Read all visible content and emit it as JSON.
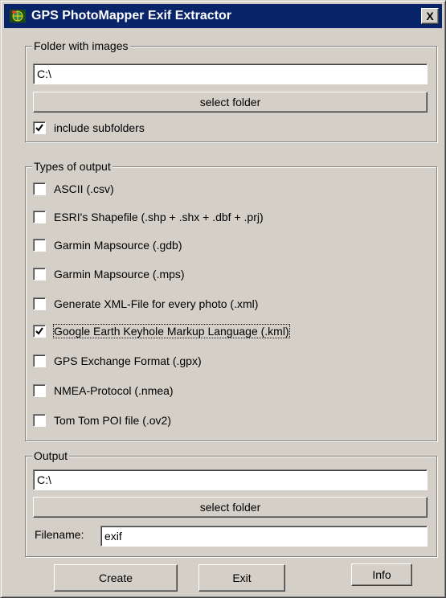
{
  "window": {
    "title": "GPS PhotoMapper Exif Extractor",
    "close_glyph": "X"
  },
  "folder_group": {
    "legend": "Folder with images",
    "path_value": "C:\\",
    "select_label": "select folder",
    "subfolders_label": "include subfolders",
    "subfolders_checked": true
  },
  "types_group": {
    "legend": "Types of output",
    "items": [
      {
        "label": "ASCII (.csv)",
        "checked": false
      },
      {
        "label": "ESRI's Shapefile (.shp + .shx + .dbf + .prj)",
        "checked": false
      },
      {
        "label": "Garmin Mapsource (.gdb)",
        "checked": false
      },
      {
        "label": "Garmin Mapsource (.mps)",
        "checked": false
      },
      {
        "label": "Generate XML-File for every photo (.xml)",
        "checked": false
      },
      {
        "label": "Google Earth Keyhole Markup Language (.kml)",
        "checked": true
      },
      {
        "label": "GPS Exchange Format (.gpx)",
        "checked": false
      },
      {
        "label": "NMEA-Protocol (.nmea)",
        "checked": false
      },
      {
        "label": "Tom Tom POI file (.ov2)",
        "checked": false
      }
    ]
  },
  "output_group": {
    "legend": "Output",
    "path_value": "C:\\",
    "select_label": "select folder",
    "filename_label": "Filename:",
    "filename_value": "exif"
  },
  "buttons": {
    "create": "Create",
    "exit": "Exit",
    "info": "Info"
  },
  "icons": {
    "app": "gps-globe-icon",
    "check": "checkmark-icon",
    "close": "close-icon"
  },
  "colors": {
    "titlebar": "#0a246a",
    "face": "#d4d0c8"
  }
}
